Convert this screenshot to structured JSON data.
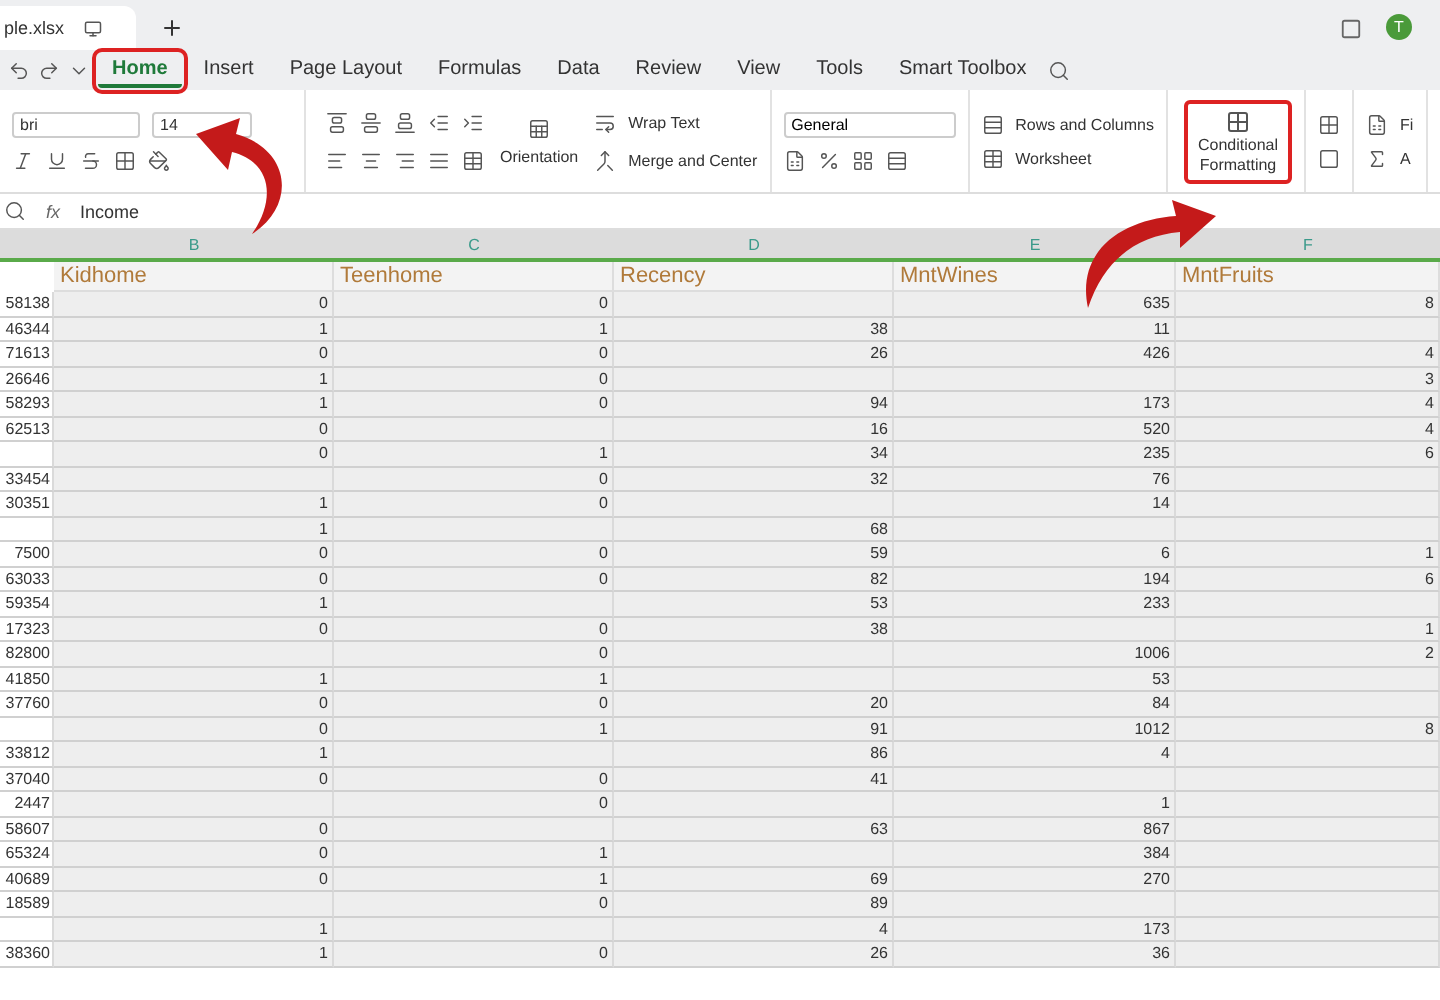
{
  "file_tab": {
    "title": "ple.xlsx"
  },
  "account": {
    "initial": "T"
  },
  "home_arrow": true,
  "ribbon_tabs": [
    {
      "label": "Home",
      "selected": true,
      "highlighted": true
    },
    {
      "label": "Insert",
      "selected": false
    },
    {
      "label": "Page Layout",
      "selected": false
    },
    {
      "label": "Formulas",
      "selected": false
    },
    {
      "label": "Data",
      "selected": false
    },
    {
      "label": "Review",
      "selected": false
    },
    {
      "label": "View",
      "selected": false
    },
    {
      "label": "Tools",
      "selected": false
    },
    {
      "label": "Smart Toolbox",
      "selected": false
    }
  ],
  "toolbar": {
    "font_name": "bri",
    "font_size": "14",
    "wrap_text": "Wrap Text",
    "orientation": "Orientation",
    "merge": "Merge and Center",
    "number_format": "General",
    "rows_columns": "Rows and Columns",
    "worksheet": "Worksheet",
    "conditional_formatting": [
      "Conditional",
      "Formatting"
    ],
    "conditional_highlighted": true,
    "conditional_pointer": true,
    "cut_1": "Fi",
    "cut_2": "A"
  },
  "formula_bar": {
    "fx": "fx",
    "value": "Income"
  },
  "columns": [
    "B",
    "C",
    "D",
    "E",
    "F"
  ],
  "headers": [
    "Kidhome",
    "Teenhome",
    "Recency",
    "MntWines",
    "MntFruits"
  ],
  "rows": [
    [
      "58138",
      "0",
      "0",
      "",
      "635",
      "8"
    ],
    [
      "46344",
      "1",
      "1",
      "38",
      "11",
      ""
    ],
    [
      "71613",
      "0",
      "0",
      "26",
      "426",
      "4"
    ],
    [
      "26646",
      "1",
      "0",
      "",
      "",
      "3"
    ],
    [
      "58293",
      "1",
      "0",
      "94",
      "173",
      "4"
    ],
    [
      "62513",
      "0",
      "",
      "16",
      "520",
      "4"
    ],
    [
      "",
      "0",
      "1",
      "34",
      "235",
      "6"
    ],
    [
      "33454",
      "",
      "0",
      "32",
      "76",
      ""
    ],
    [
      "30351",
      "1",
      "0",
      "",
      "14",
      ""
    ],
    [
      "",
      "1",
      "",
      "68",
      "",
      ""
    ],
    [
      "7500",
      "0",
      "0",
      "59",
      "6",
      "1"
    ],
    [
      "63033",
      "0",
      "0",
      "82",
      "194",
      "6"
    ],
    [
      "59354",
      "1",
      "",
      "53",
      "233",
      ""
    ],
    [
      "17323",
      "0",
      "0",
      "38",
      "",
      "1"
    ],
    [
      "82800",
      "",
      "0",
      "",
      "1006",
      "2"
    ],
    [
      "41850",
      "1",
      "1",
      "",
      "53",
      ""
    ],
    [
      "37760",
      "0",
      "0",
      "20",
      "84",
      ""
    ],
    [
      "",
      "0",
      "1",
      "91",
      "1012",
      "8"
    ],
    [
      "33812",
      "1",
      "",
      "86",
      "4",
      ""
    ],
    [
      "37040",
      "0",
      "0",
      "41",
      "",
      ""
    ],
    [
      "2447",
      "",
      "0",
      "",
      "1",
      ""
    ],
    [
      "58607",
      "0",
      "",
      "63",
      "867",
      ""
    ],
    [
      "65324",
      "0",
      "1",
      "",
      "384",
      ""
    ],
    [
      "40689",
      "0",
      "1",
      "69",
      "270",
      ""
    ],
    [
      "18589",
      "",
      "0",
      "89",
      "",
      ""
    ],
    [
      "",
      "1",
      "",
      "4",
      "173",
      ""
    ],
    [
      "38360",
      "1",
      "0",
      "26",
      "36",
      ""
    ]
  ]
}
